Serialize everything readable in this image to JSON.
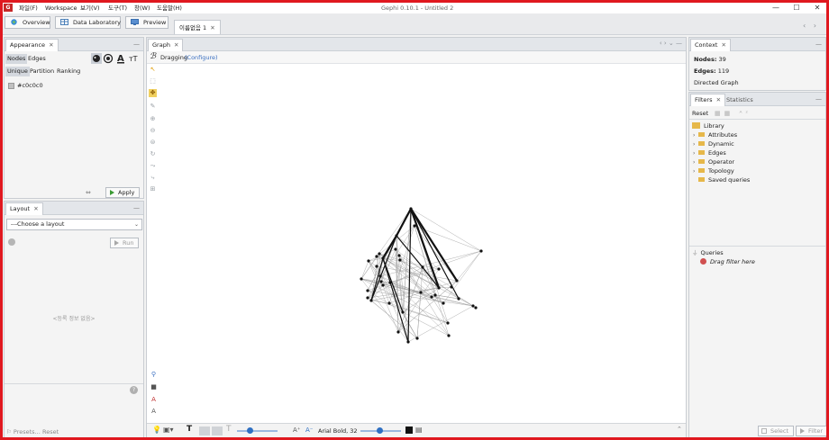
{
  "menu": {
    "app_icon": "gephi-icon",
    "items": [
      "파일(F)",
      "Workspace",
      "보기(V)",
      "도구(T)",
      "창(W)",
      "도움말(H)"
    ],
    "window_title": "Gephi 0.10.1 - Untitled 2",
    "minimize": "—",
    "maximize": "☐",
    "close": "✕"
  },
  "workspace": {
    "overview": "Overview",
    "data_laboratory": "Data Laboratory",
    "preview": "Preview",
    "project_tab": "이름없음 1",
    "project_tab_close": "✕",
    "nav_arrows": "‹ ›"
  },
  "appearance": {
    "tab": "Appearance",
    "close": "✕",
    "minimize": "—",
    "nodes": "Nodes",
    "edges": "Edges",
    "unique": "Unique",
    "partition": "Partition",
    "ranking": "Ranking",
    "color_value": "#c0c0c0",
    "icons": [
      "palette-icon",
      "size-icon",
      "label-color-icon",
      "label-size-icon"
    ],
    "apply": "Apply"
  },
  "layout": {
    "tab": "Layout",
    "close": "✕",
    "minimize": "—",
    "choose": "---Choose a layout",
    "run": "Run",
    "empty": "<등록 정보 없음>",
    "presets": "Presets...",
    "reset": "Reset"
  },
  "graph": {
    "tab": "Graph",
    "close": "✕",
    "mode": "Dragging",
    "configure": "(Configure)",
    "font": "Arial Bold, 32",
    "font_size_up": "A⁺",
    "font_size_down": "A⁻",
    "nodes": 39,
    "edges": 119,
    "tools": [
      "cursor-icon",
      "rectangle-select-icon",
      "drag-icon",
      "painter-icon",
      "zoom-icon",
      "shortest-path-icon",
      "heat-map-icon",
      "rotate-icon",
      "edge-pencil-icon",
      "node-pencil-icon",
      "grid-icon"
    ]
  },
  "context": {
    "tab": "Context",
    "close": "✕",
    "minimize": "—",
    "nodes_label": "Nodes:",
    "nodes_value": "39",
    "edges_label": "Edges:",
    "edges_value": "119",
    "graph_type": "Directed Graph"
  },
  "filters": {
    "tab": "Filters",
    "close": "✕",
    "statistics": "Statistics",
    "minimize": "—",
    "reset": "Reset",
    "library": "Library",
    "items": [
      "Attributes",
      "Dynamic",
      "Edges",
      "Operator",
      "Topology",
      "Saved queries"
    ],
    "queries": "Queries",
    "drag_here": "Drag filter here",
    "select": "Select",
    "filter": "Filter"
  },
  "colors": {
    "accent": "#e0181f",
    "panel": "#f4f4f4",
    "apply_green": "#3a9a34"
  }
}
